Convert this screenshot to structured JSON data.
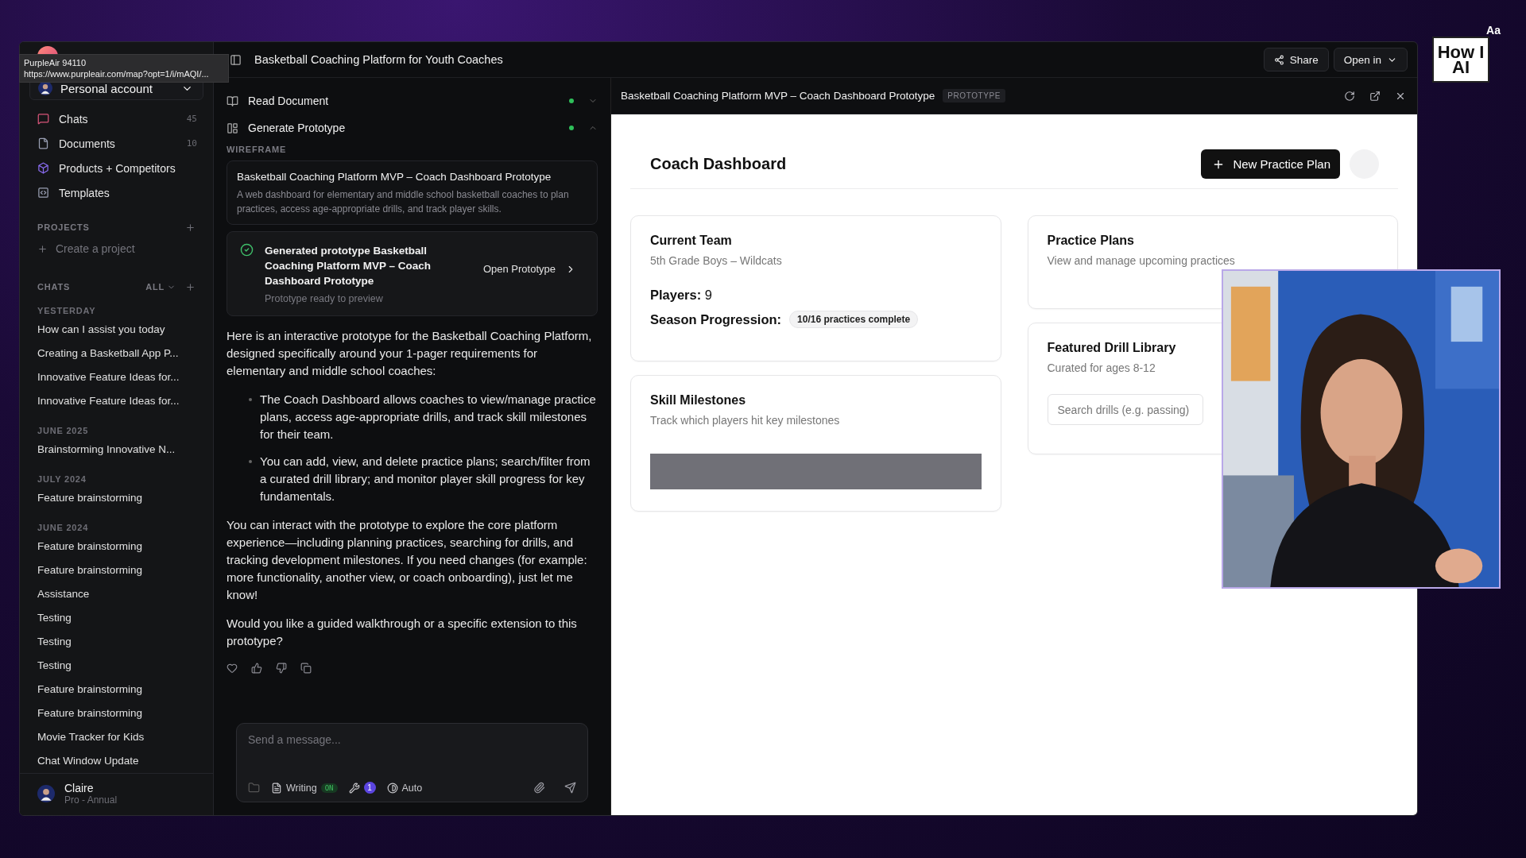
{
  "tooltip": {
    "title": "PurpleAir 94110",
    "url": "https://www.purpleair.com/map?opt=1/i/mAQI/..."
  },
  "sidebar": {
    "account": "Personal account",
    "nav": [
      {
        "label": "Chats",
        "count": "45",
        "kind": "chats"
      },
      {
        "label": "Documents",
        "count": "10",
        "kind": "documents"
      },
      {
        "label": "Products + Competitors",
        "kind": "products"
      },
      {
        "label": "Templates",
        "kind": "templates"
      }
    ],
    "projects": {
      "heading": "PROJECTS",
      "create": "Create a project"
    },
    "chats": {
      "heading": "CHATS",
      "filter": "ALL",
      "groups": [
        {
          "label": "YESTERDAY",
          "items": [
            "How can I assist you today",
            "Creating a Basketball App P...",
            "Innovative Feature Ideas for...",
            "Innovative Feature Ideas for..."
          ]
        },
        {
          "label": "JUNE 2025",
          "items": [
            "Brainstorming Innovative N..."
          ]
        },
        {
          "label": "JULY 2024",
          "items": [
            "Feature brainstorming"
          ]
        },
        {
          "label": "JUNE 2024",
          "items": [
            "Feature brainstorming",
            "Feature brainstorming",
            "Assistance",
            "Testing",
            "Testing",
            "Testing",
            "Feature brainstorming",
            "Feature brainstorming",
            "Movie Tracker for Kids",
            "Chat Window Update"
          ]
        }
      ]
    },
    "user": {
      "name": "Claire",
      "plan": "Pro - Annual"
    }
  },
  "chat": {
    "title": "Basketball Coaching Platform for Youth Coaches",
    "steps": [
      {
        "label": "Read Document",
        "kind": "document",
        "done": true,
        "expanded": false
      },
      {
        "label": "Generate Prototype",
        "kind": "prototype",
        "done": true,
        "expanded": true
      }
    ],
    "section_label": "WIREFRAME",
    "wireframe": {
      "title": "Basketball Coaching Platform MVP – Coach Dashboard Prototype",
      "description": "A web dashboard for elementary and middle school basketball coaches to plan practices, access age-appropriate drills, and track player skills."
    },
    "result": {
      "title": "Generated prototype Basketball Coaching Platform MVP – Coach Dashboard Prototype",
      "subtitle": "Prototype ready to preview",
      "action": "Open Prototype"
    },
    "message": [
      {
        "kind": "paragraph",
        "text": "Here is an interactive prototype for the Basketball Coaching Platform, designed specifically around your 1-pager requirements for elementary and middle school coaches:"
      },
      {
        "kind": "bullets",
        "items": [
          "The Coach Dashboard allows coaches to view/manage practice plans, access age-appropriate drills, and track skill milestones for their team.",
          "You can add, view, and delete practice plans; search/filter from a curated drill library; and monitor player skill progress for key fundamentals."
        ]
      },
      {
        "kind": "paragraph",
        "text": "You can interact with the prototype to explore the core platform experience—including planning practices, searching for drills, and tracking development milestones. If you need changes (for example: more functionality, another view, or coach onboarding), just let me know!"
      },
      {
        "kind": "paragraph",
        "text": "Would you like a guided walkthrough or a specific extension to this prototype?"
      }
    ],
    "composer": {
      "placeholder": "Send a message...",
      "mode": "Writing",
      "mode_badge": "ON",
      "tools_count": "1",
      "model": "Auto"
    }
  },
  "toolbar": {
    "share": "Share",
    "open_in": "Open in"
  },
  "preview": {
    "title": "Basketball Coaching Platform MVP – Coach Dashboard Prototype",
    "badge": "PROTOTYPE",
    "dashboard": {
      "title": "Coach Dashboard",
      "primary_action": "New Practice Plan",
      "left_cards": [
        {
          "kind": "team",
          "title": "Current Team",
          "subtitle": "5th Grade Boys – Wildcats",
          "players": "**Players:** 9",
          "progress_label": "Season Progression:",
          "progress_badge": "10/16 practices complete"
        },
        {
          "kind": "milestones",
          "title": "Skill Milestones",
          "subtitle": "Track which players hit key milestones"
        }
      ],
      "right_cards": [
        {
          "kind": "plans",
          "title": "Practice Plans",
          "subtitle": "View and manage upcoming practices"
        },
        {
          "kind": "drills",
          "title": "Featured Drill Library",
          "subtitle": "Curated for ages 8-12",
          "search_placeholder": "Search drills (e.g. passing)"
        }
      ]
    }
  },
  "logo": {
    "text": "How I AI",
    "corner": "Aa"
  }
}
